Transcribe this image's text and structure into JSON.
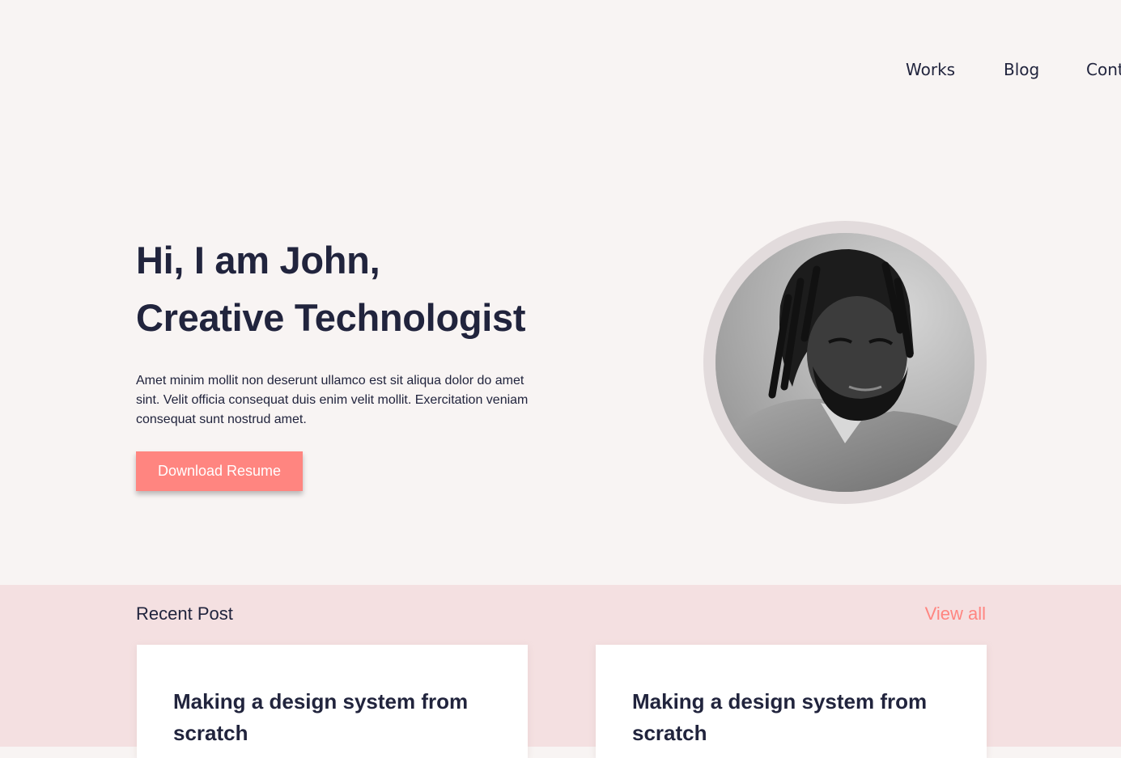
{
  "nav": {
    "items": [
      {
        "label": "Works"
      },
      {
        "label": "Blog"
      },
      {
        "label": "Contact"
      }
    ]
  },
  "hero": {
    "title_line1": "Hi, I am John,",
    "title_line2": "Creative Technologist",
    "description": "Amet minim mollit non deserunt ullamco est sit aliqua dolor do amet sint. Velit officia consequat duis enim velit mollit. Exercitation veniam consequat sunt nostrud amet.",
    "cta_label": "Download Resume",
    "avatar_alt": "Portrait photo"
  },
  "recent": {
    "title": "Recent Post",
    "view_all_label": "View all",
    "posts": [
      {
        "title": "Making a design system from scratch"
      },
      {
        "title": "Making a design system from scratch"
      }
    ]
  },
  "colors": {
    "background": "#f8f4f3",
    "accent": "#ff8580",
    "section_bg": "#f4e0e1",
    "text": "#21243d"
  }
}
